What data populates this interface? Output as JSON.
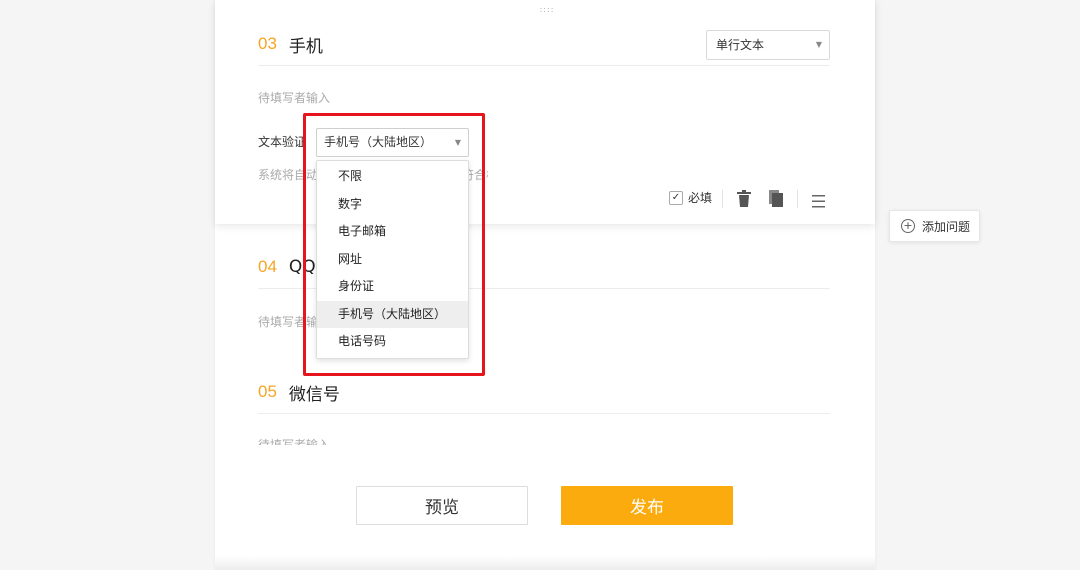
{
  "drag_handle": "::::",
  "questions": [
    {
      "number": "03",
      "title": "手机",
      "placeholder": "待填写者输入"
    },
    {
      "number": "04",
      "title": "QQ",
      "placeholder": "待填写者输入"
    },
    {
      "number": "05",
      "title": "微信号",
      "placeholder": "待填写者输入"
    }
  ],
  "type_select": {
    "value": "单行文本"
  },
  "validation": {
    "label": "文本验证",
    "value": "手机号（大陆地区）",
    "hint": "系统将自动校验填写者输入的内容是否符合格式",
    "options": [
      "不限",
      "数字",
      "电子邮箱",
      "网址",
      "身份证",
      "手机号（大陆地区）",
      "电话号码"
    ],
    "selected_index": 5
  },
  "toolbar": {
    "required_label": "必填",
    "required_checked": true
  },
  "add_question_label": "添加问题",
  "buttons": {
    "preview": "预览",
    "publish": "发布"
  },
  "colors": {
    "accent": "#f5a623",
    "publish": "#fbab0e",
    "highlight": "#e5141d"
  },
  "icons": [
    "check-icon",
    "trash-icon",
    "copy-icon",
    "menu-icon",
    "plus-circle-icon",
    "caret-down-icon",
    "drag-handle-icon"
  ]
}
